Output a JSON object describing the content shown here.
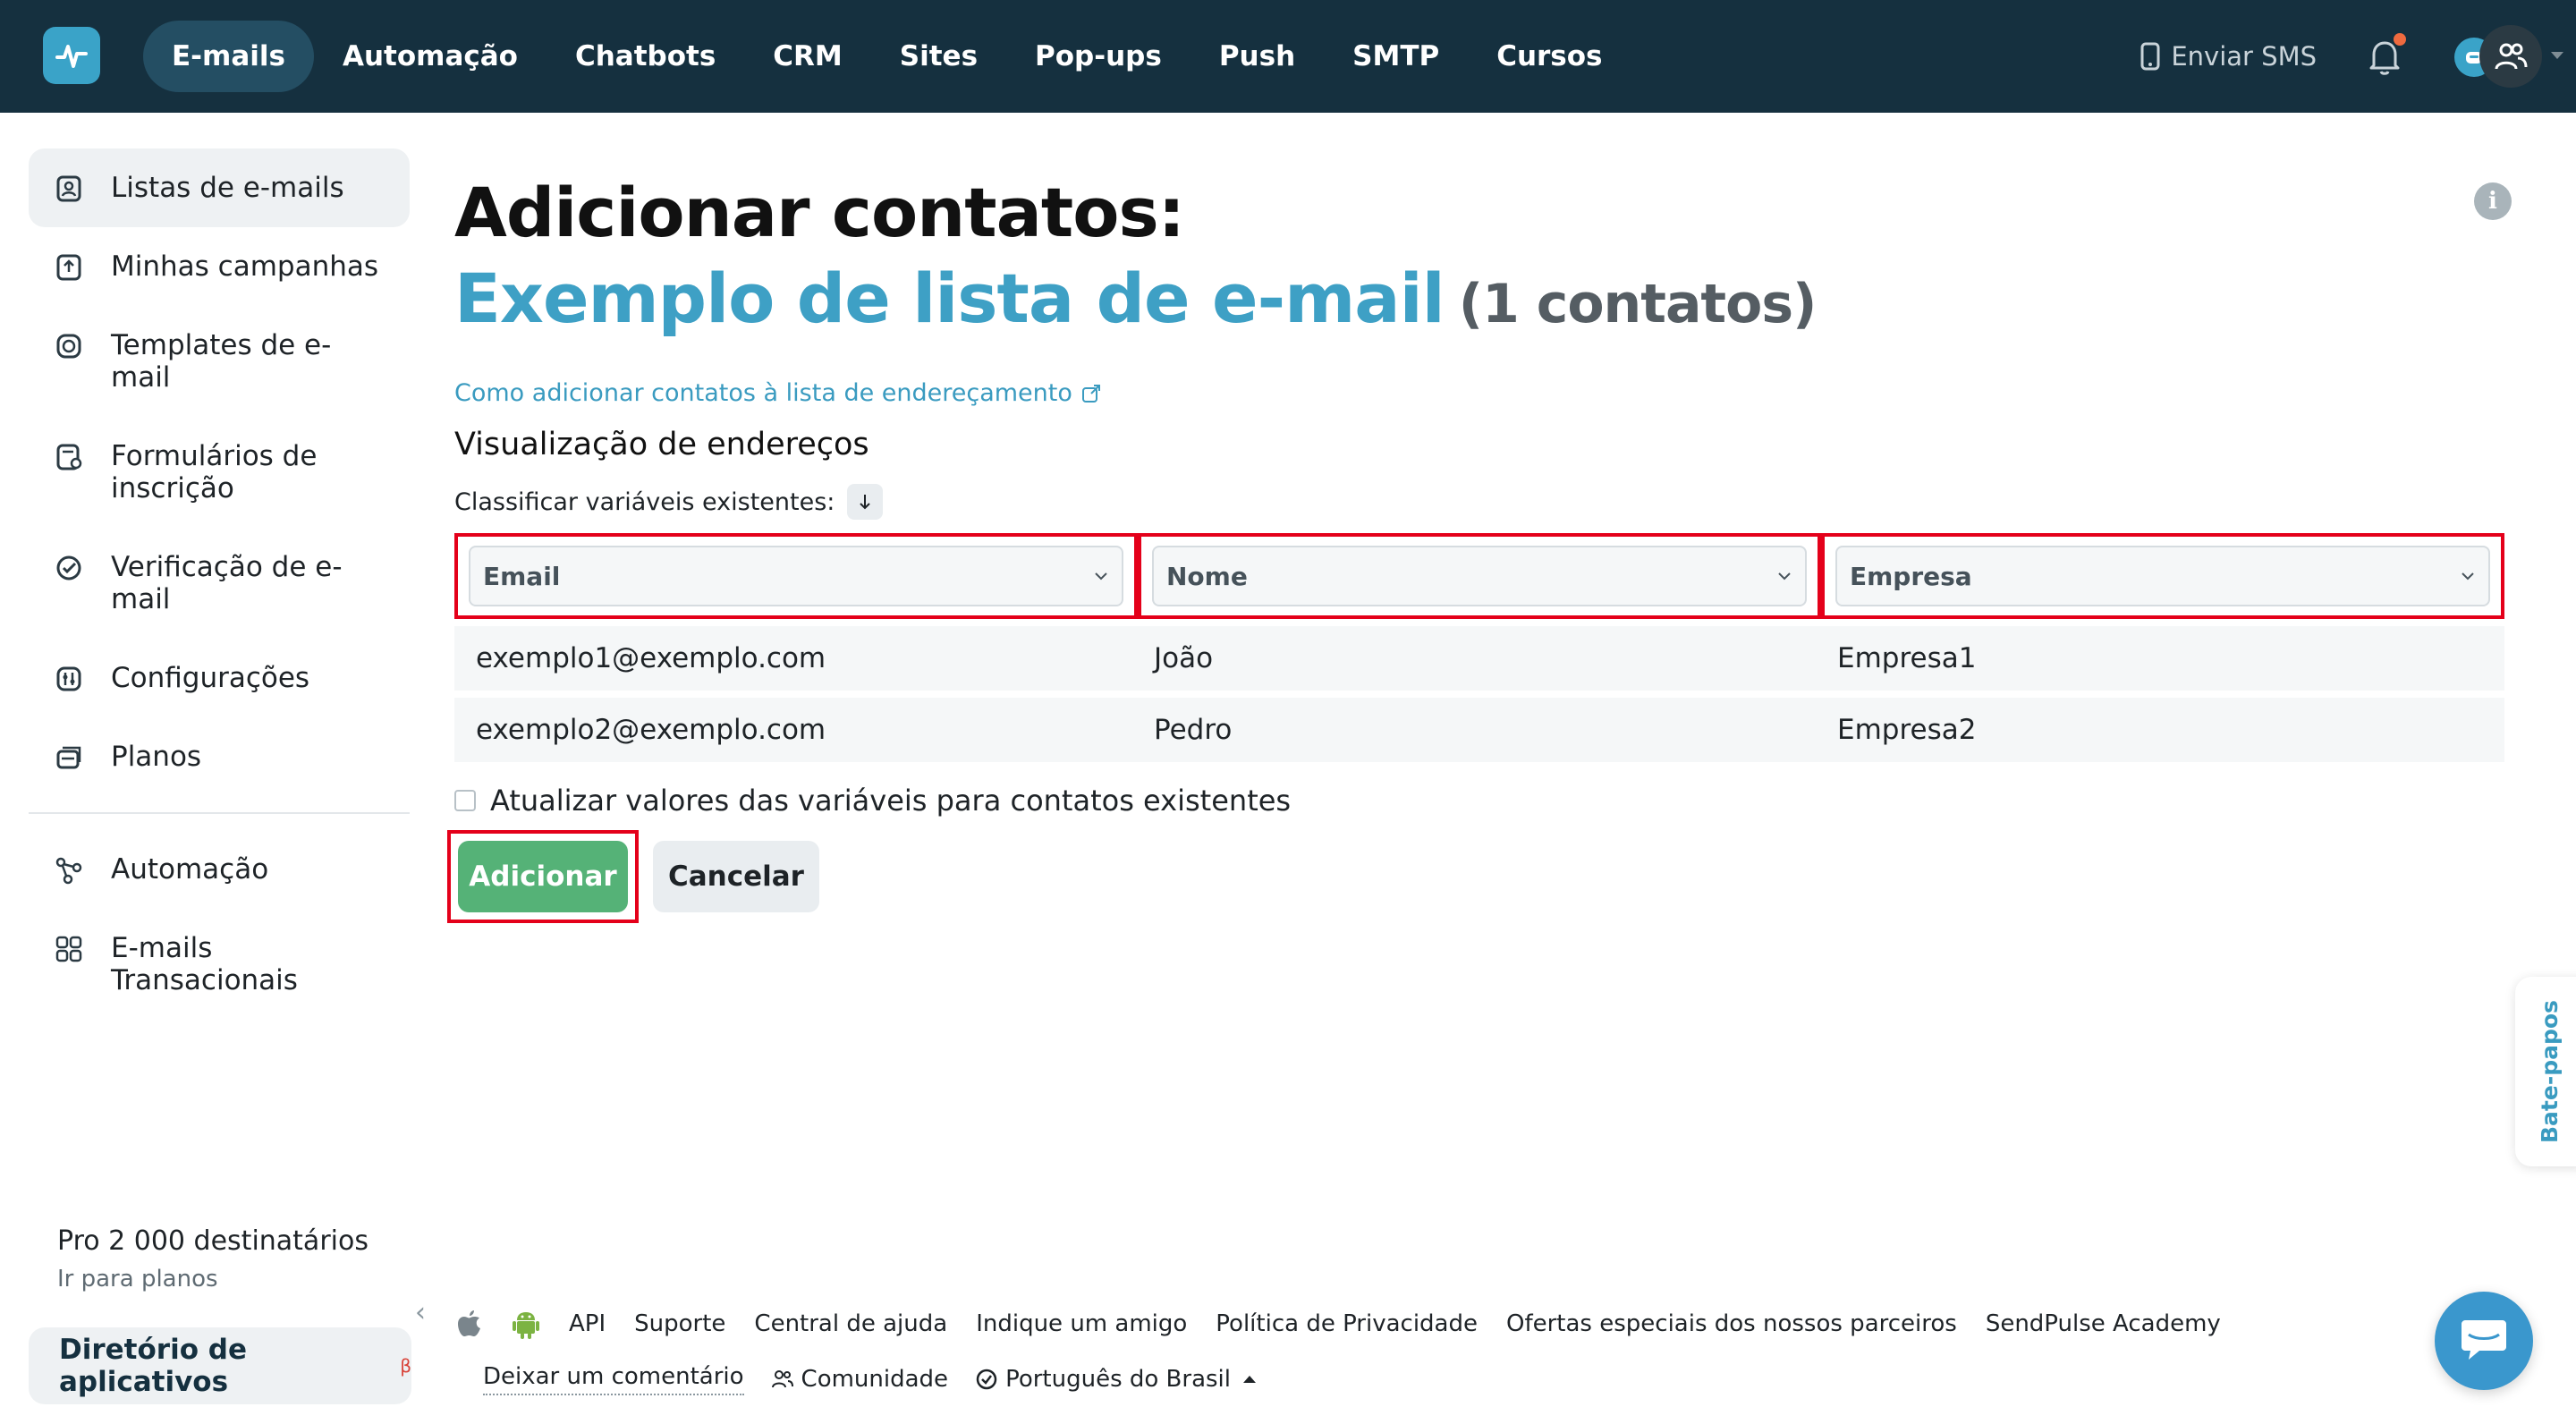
{
  "nav": {
    "items": [
      "E-mails",
      "Automação",
      "Chatbots",
      "CRM",
      "Sites",
      "Pop-ups",
      "Push",
      "SMTP",
      "Cursos"
    ],
    "active_index": 0,
    "send_sms": "Enviar SMS"
  },
  "sidebar": {
    "items": [
      {
        "label": "Listas de e-mails",
        "icon": "contact-list-icon"
      },
      {
        "label": "Minhas campanhas",
        "icon": "campaign-upload-icon"
      },
      {
        "label": "Templates de e-mail",
        "icon": "template-icon"
      },
      {
        "label": "Formulários de inscrição",
        "icon": "form-icon"
      },
      {
        "label": "Verificação de e-mail",
        "icon": "check-circle-icon"
      },
      {
        "label": "Configurações",
        "icon": "settings-sliders-icon"
      },
      {
        "label": "Planos",
        "icon": "plans-icon"
      },
      {
        "label": "Automação",
        "icon": "automation-flow-icon"
      },
      {
        "label": "E-mails Transacionais",
        "icon": "grid-icon"
      }
    ],
    "active_index": 0,
    "plan": {
      "title": "Pro 2 000 destinatários",
      "link": "Ir para planos"
    },
    "apps_directory": {
      "label": "Diretório de aplicativos",
      "badge": "β"
    }
  },
  "main": {
    "title": "Adicionar contatos:",
    "list_name": "Exemplo de lista de e-mail",
    "list_count": "(1 contatos)",
    "help_link": "Como adicionar contatos à lista de endereçamento",
    "preview_title": "Visualização de endereços",
    "sort_label": "Classificar variáveis existentes:",
    "columns": [
      "Email",
      "Nome",
      "Empresa"
    ],
    "rows": [
      [
        "exemplo1@exemplo.com",
        "João",
        "Empresa1"
      ],
      [
        "exemplo2@exemplo.com",
        "Pedro",
        "Empresa2"
      ]
    ],
    "update_checkbox": {
      "label": "Atualizar valores das variáveis para contatos existentes",
      "checked": false
    },
    "add_button": "Adicionar",
    "cancel_button": "Cancelar"
  },
  "footer": {
    "links_row1": [
      "API",
      "Suporte",
      "Central de ajuda",
      "Indique um amigo",
      "Política de Privacidade",
      "Ofertas especiais dos nossos parceiros",
      "SendPulse Academy"
    ],
    "feedback": "Deixar um comentário",
    "community": "Comunidade",
    "language": "Português do Brasil"
  },
  "chat": {
    "tab_label": "Bate-papos"
  },
  "colors": {
    "topbar": "#15303f",
    "accent_blue": "#3ea0c5",
    "add_green": "#55b277",
    "highlight_red": "#e4001a"
  }
}
